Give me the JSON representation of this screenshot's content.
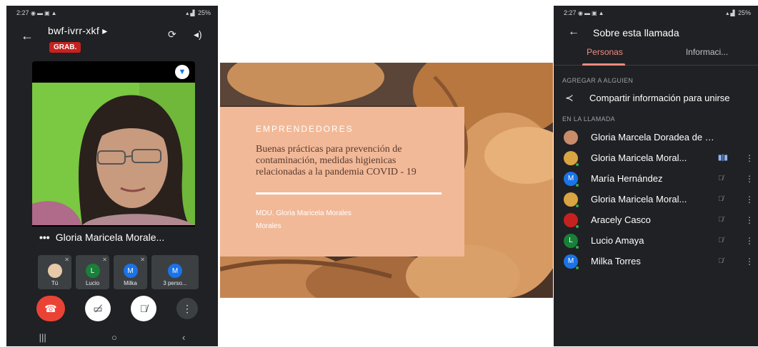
{
  "left_phone": {
    "status_time": "2:27",
    "status_right": "25%",
    "meeting_code": "bwf-ivrr-xkf ▸",
    "recording_badge": "GRAB.",
    "main_tile_name": "Gloria Maricela Morale...",
    "main_tile_dots": "•••",
    "participants": [
      {
        "label": "Tú",
        "initial": "",
        "color": "#e8c9a8"
      },
      {
        "label": "Lucio",
        "initial": "L",
        "color": "#188038"
      },
      {
        "label": "Milka",
        "initial": "M",
        "color": "#1a73e8"
      },
      {
        "label": "3 perso...",
        "initial": "M",
        "color": "#1a73e8"
      }
    ]
  },
  "slide": {
    "tag": "EMPRENDEDORES",
    "headline": "Buenas prácticas para prevención de contaminación, medidas higienicas relacionadas a la pandemia COVID - 19",
    "author": "MDU. Gloria Maricela Morales Morales"
  },
  "right_phone": {
    "status_time": "2:27",
    "status_right": "25%",
    "title": "Sobre esta llamada",
    "tabs": [
      "Personas",
      "Informaci..."
    ],
    "add_section": "AGREGAR A ALGUIEN",
    "share_label": "Compartir información para unirse",
    "in_call_section": "EN LA LLAMADA",
    "people": [
      {
        "name": "Gloria Marcela Doradea de Hern...",
        "initial": "",
        "color": "#c98b6a",
        "mic": "",
        "more": ""
      },
      {
        "name": "Gloria Maricela Moral...",
        "initial": "",
        "color": "#d9a441",
        "mic": "▮|▮",
        "more": "⋮"
      },
      {
        "name": "María Hernández",
        "initial": "M",
        "color": "#1a73e8",
        "mic": "🎙̸",
        "more": "⋮"
      },
      {
        "name": "Gloria Maricela Moral...",
        "initial": "",
        "color": "#d9a441",
        "mic": "🎙̸",
        "more": "⋮"
      },
      {
        "name": "Aracely Casco",
        "initial": "",
        "color": "#c5221f",
        "mic": "🎙̸",
        "more": "⋮"
      },
      {
        "name": "Lucio Amaya",
        "initial": "L",
        "color": "#188038",
        "mic": "🎙̸",
        "more": "⋮"
      },
      {
        "name": "Milka Torres",
        "initial": "M",
        "color": "#1a73e8",
        "mic": "🎙̸",
        "more": "⋮"
      }
    ]
  },
  "colors": {
    "phone_bg": "#202124",
    "end_call": "#ea4335",
    "accent_tab": "#f28b82",
    "slide_card": "#f2b998",
    "recording": "#c5221f"
  }
}
